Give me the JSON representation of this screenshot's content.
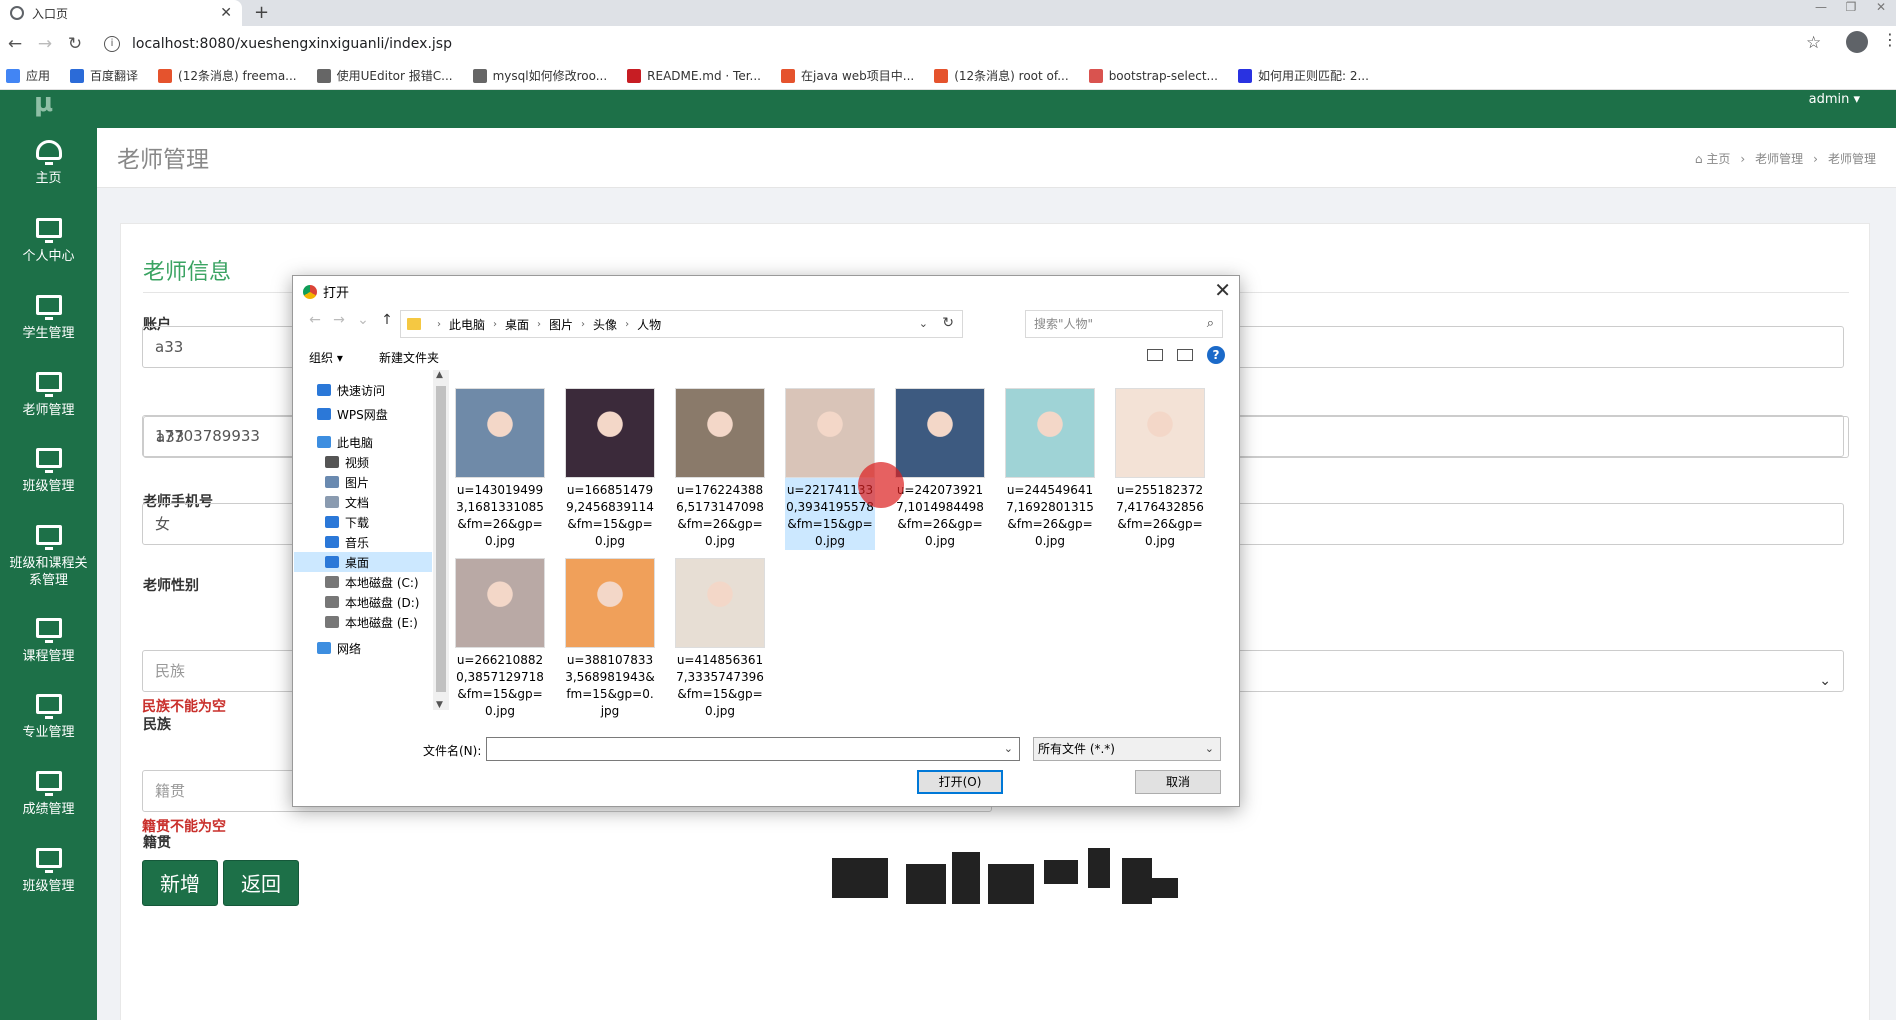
{
  "browser": {
    "tab_title": "入口页",
    "url": "localhost:8080/xueshengxinxiguanli/index.jsp",
    "bookmarks": [
      {
        "label": "应用",
        "color": "#4285f4"
      },
      {
        "label": "百度翻译",
        "color": "#2b6bd8"
      },
      {
        "label": "(12条消息) freema...",
        "color": "#e5532d"
      },
      {
        "label": "使用UEditor 报错C...",
        "color": "#666666"
      },
      {
        "label": "mysql如何修改roo...",
        "color": "#666666"
      },
      {
        "label": "README.md · Ter...",
        "color": "#c71d23"
      },
      {
        "label": "在java web项目中...",
        "color": "#e5532d"
      },
      {
        "label": "(12条消息) root of...",
        "color": "#e5532d"
      },
      {
        "label": "bootstrap-select...",
        "color": "#d9534f"
      },
      {
        "label": "如何用正则匹配: 2...",
        "color": "#2932e1"
      }
    ]
  },
  "topbar": {
    "user": "admin ▾"
  },
  "sidebar": {
    "logo": "μ",
    "items": [
      {
        "label": "主页"
      },
      {
        "label": "个人中心"
      },
      {
        "label": "学生管理"
      },
      {
        "label": "老师管理"
      },
      {
        "label": "班级管理"
      },
      {
        "label": "班级和课程关系管理"
      },
      {
        "label": "课程管理"
      },
      {
        "label": "专业管理"
      },
      {
        "label": "成绩管理"
      },
      {
        "label": "班级管理"
      }
    ]
  },
  "page": {
    "title": "老师管理",
    "breadcrumb": [
      "主页",
      "老师管理",
      "老师管理"
    ]
  },
  "form": {
    "title": "老师信息",
    "account_label": "账户",
    "account_value": "a33",
    "phone_label": "老师手机号",
    "phone_value": "17703789933",
    "gender_label": "老师性别",
    "gender_value": "女",
    "ethnic_label": "民族",
    "ethnic_placeholder": "民族",
    "ethnic_error": "民族不能为空",
    "native_label": "籍贯",
    "native_placeholder": "籍贯",
    "native_error": "籍贯不能为空",
    "add_button": "新增",
    "back_button": "返回"
  },
  "dialog": {
    "title": "打开",
    "path": [
      "此电脑",
      "桌面",
      "图片",
      "头像",
      "人物"
    ],
    "search_placeholder": "搜索\"人物\"",
    "organize": "组织 ▾",
    "new_folder": "新建文件夹",
    "nav_items": [
      {
        "label": "快速访问",
        "icon": "star-icon"
      },
      {
        "label": "WPS网盘",
        "icon": "cloud-icon"
      },
      {
        "label": "此电脑",
        "icon": "computer-icon"
      },
      {
        "label": "视频",
        "icon": "video-icon"
      },
      {
        "label": "图片",
        "icon": "picture-icon"
      },
      {
        "label": "文档",
        "icon": "document-icon"
      },
      {
        "label": "下载",
        "icon": "download-icon"
      },
      {
        "label": "音乐",
        "icon": "music-icon"
      },
      {
        "label": "桌面",
        "icon": "desktop-icon"
      },
      {
        "label": "本地磁盘 (C:)",
        "icon": "disk-icon"
      },
      {
        "label": "本地磁盘 (D:)",
        "icon": "disk-icon"
      },
      {
        "label": "本地磁盘 (E:)",
        "icon": "disk-icon"
      },
      {
        "label": "网络",
        "icon": "network-icon"
      }
    ],
    "selected_nav": "桌面",
    "files": [
      {
        "name": "u=1430194993,1681331085&fm=26&gp=0.jpg",
        "color": "#6f8aa8"
      },
      {
        "name": "u=1668514799,2456839114&fm=15&gp=0.jpg",
        "color": "#3b2a3a"
      },
      {
        "name": "u=1762243886,5173147098&fm=26&gp=0.jpg",
        "color": "#8a7a6a"
      },
      {
        "name": "u=2217411330,3934195578&fm=15&gp=0.jpg",
        "color": "#d9c4b8"
      },
      {
        "name": "u=2420739217,1014984498&fm=26&gp=0.jpg",
        "color": "#3d5a80"
      },
      {
        "name": "u=2445496417,1692801315&fm=26&gp=0.jpg",
        "color": "#9fd3d6"
      },
      {
        "name": "u=2551823727,4176432856&fm=26&gp=0.jpg",
        "color": "#f3e2d6"
      },
      {
        "name": "u=2662108820,3857129718&fm=15&gp=0.jpg",
        "color": "#b9a9a5"
      },
      {
        "name": "u=3881078333,568981943&fm=15&gp=0.jpg",
        "color": "#f0a05a"
      },
      {
        "name": "u=4148563617,3335747396&fm=15&gp=0.jpg",
        "color": "#e7ded4"
      }
    ],
    "selected_file_index": 3,
    "filename_label": "文件名(N):",
    "filename_value": "",
    "filetype": "所有文件 (*.*)",
    "open_button": "打开(O)",
    "cancel_button": "取消"
  }
}
